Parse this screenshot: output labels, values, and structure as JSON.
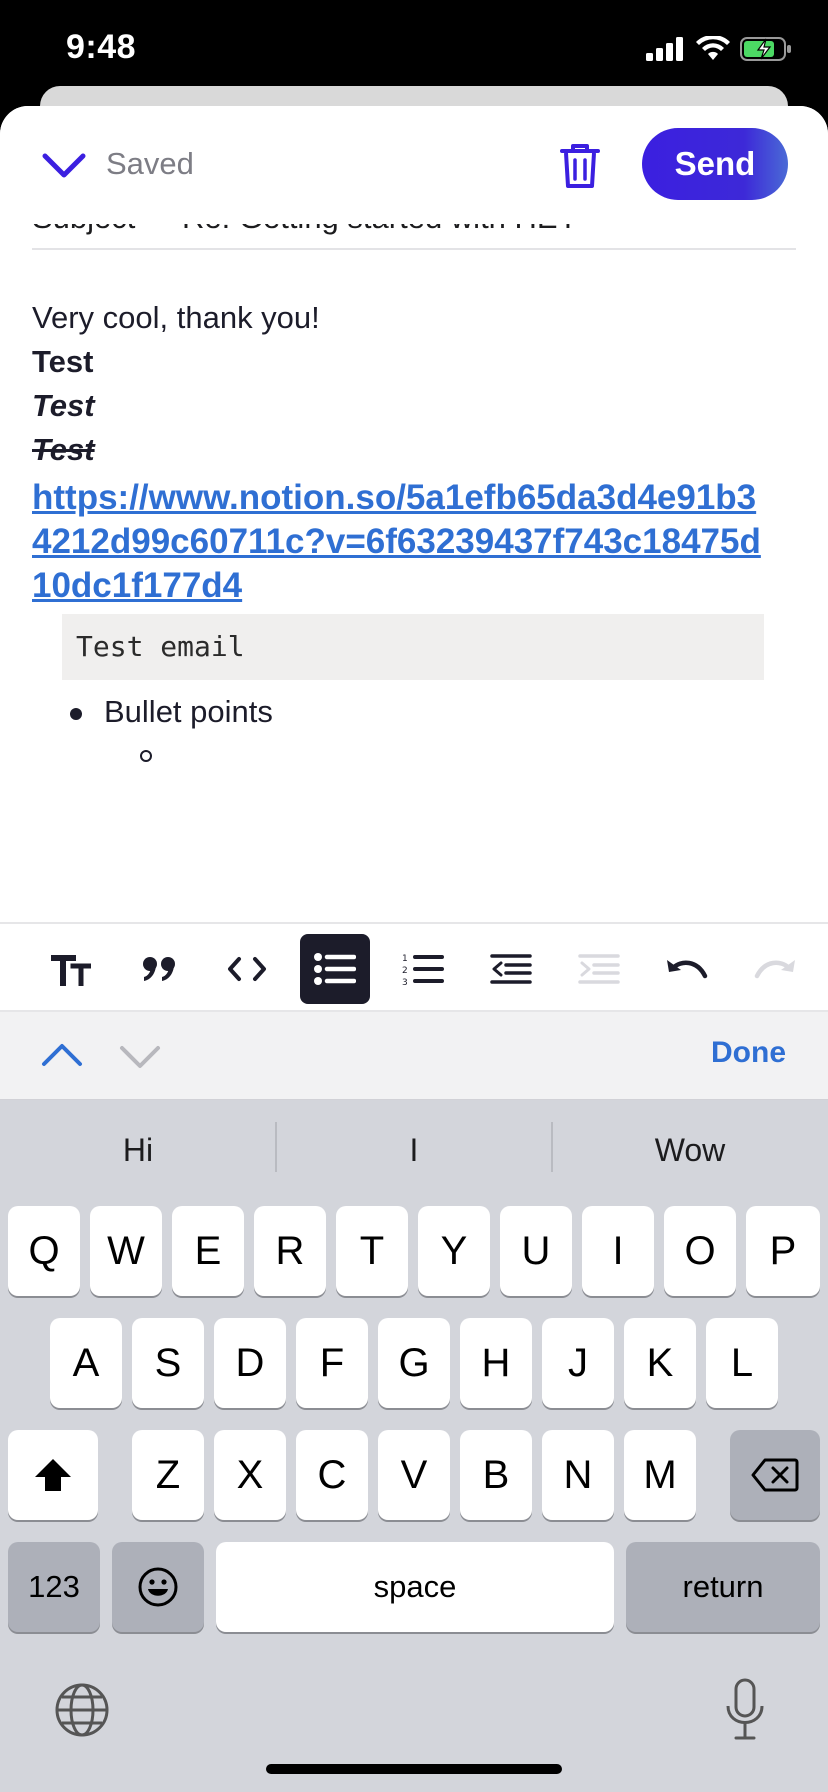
{
  "status": {
    "time": "9:48"
  },
  "header": {
    "saved_label": "Saved",
    "send_label": "Send"
  },
  "subject": {
    "label": "Subject",
    "value": "Re: Getting started with HEY"
  },
  "body": {
    "line1": "Very cool, thank you!",
    "bold": "Test",
    "italic_bold": "Test",
    "strike": "Test",
    "link": "https://www.notion.so/5a1efb65da3d4e91b34212d99c60711c?v=6f63239437f743c18475d10dc1f177d4",
    "code": "Test email",
    "bullet": "Bullet points"
  },
  "toolbar": {
    "icons": [
      "text-size-icon",
      "quote-icon",
      "code-icon",
      "bullet-list-icon",
      "numbered-list-icon",
      "outdent-icon",
      "indent-icon",
      "undo-icon",
      "redo-icon"
    ],
    "active": "bullet-list-icon"
  },
  "accessory": {
    "done_label": "Done"
  },
  "keyboard": {
    "suggestions": [
      "Hi",
      "I",
      "Wow"
    ],
    "row1": [
      "Q",
      "W",
      "E",
      "R",
      "T",
      "Y",
      "U",
      "I",
      "O",
      "P"
    ],
    "row2": [
      "A",
      "S",
      "D",
      "F",
      "G",
      "H",
      "J",
      "K",
      "L"
    ],
    "row3": [
      "Z",
      "X",
      "C",
      "V",
      "B",
      "N",
      "M"
    ],
    "numbers_label": "123",
    "space_label": "space",
    "return_label": "return"
  },
  "colors": {
    "accent": "#3b1fe0",
    "link": "#2f6fd3",
    "toolbar_active": "#1c1c2a"
  }
}
